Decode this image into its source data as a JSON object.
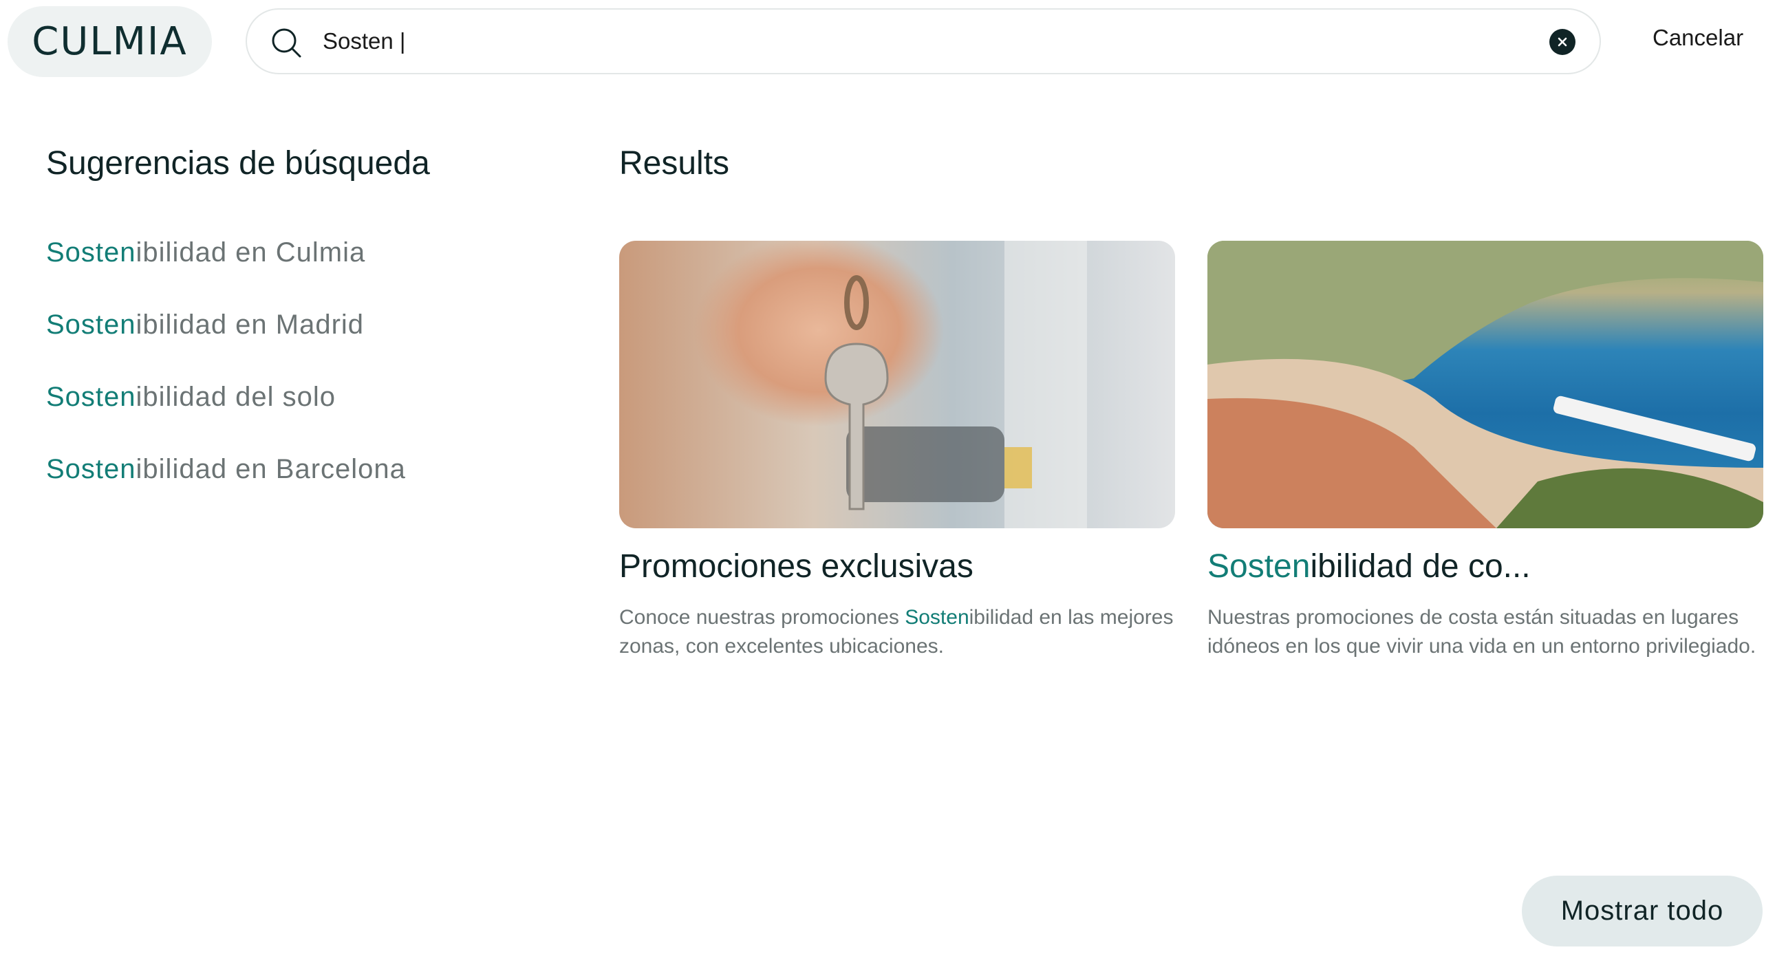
{
  "header": {
    "logo": "CULMIA",
    "search": {
      "value": "Sosten |",
      "placeholder": ""
    },
    "cancel_label": "Cancelar"
  },
  "suggestions": {
    "title": "Sugerencias de búsqueda",
    "items": [
      {
        "match": "Sosten",
        "rest": "ibilidad en Culmia"
      },
      {
        "match": "Sosten",
        "rest": "ibilidad en Madrid"
      },
      {
        "match": "Sosten",
        "rest": "ibilidad del solo"
      },
      {
        "match": "Sosten",
        "rest": "ibilidad en Barcelona"
      }
    ]
  },
  "results": {
    "title": "Results",
    "cards": [
      {
        "title_match": "",
        "title_rest": "Promociones exclusivas",
        "desc_before": "Conoce nuestras promociones ",
        "desc_match": "Sosten",
        "desc_after": "ibilidad en las mejores zonas, con excelentes ubicaciones."
      },
      {
        "title_match": "Sosten",
        "title_rest": "ibilidad de co...",
        "desc_before": "Nuestras promociones de costa están situadas en lugares idóneos en los que vivir una vida en un entorno privilegiado.",
        "desc_match": "",
        "desc_after": ""
      }
    ]
  },
  "footer": {
    "show_all_label": "Mostrar todo"
  },
  "colors": {
    "accent": "#127d76",
    "text": "#102426",
    "muted": "#6b7374",
    "pill_bg": "#e2eaeb"
  }
}
